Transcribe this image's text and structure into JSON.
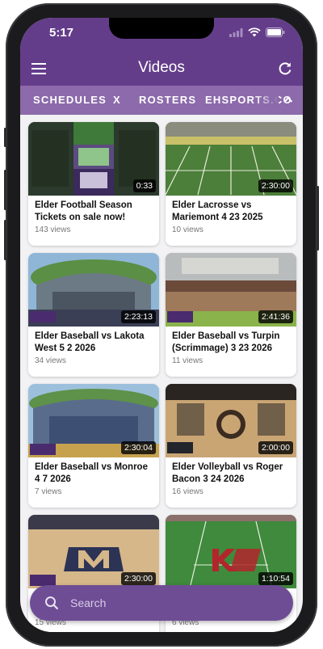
{
  "status": {
    "time": "5:17"
  },
  "header": {
    "title": "Videos"
  },
  "tabs": [
    {
      "label": "SCHEDULES"
    },
    {
      "label": "X"
    },
    {
      "label": "ROSTERS"
    },
    {
      "label": "EHSPORTS.CO"
    }
  ],
  "videos": [
    {
      "title": "Elder Football Season Tickets on sale now!",
      "views": "143 views",
      "duration": "0:33"
    },
    {
      "title": "Elder Lacrosse vs Mariemont 4 23 2025",
      "views": "10 views",
      "duration": "2:30:00"
    },
    {
      "title": "Elder Baseball vs Lakota West 5 2 2026",
      "views": "34 views",
      "duration": "2:23:13"
    },
    {
      "title": "Elder Baseball vs Turpin (Scrimmage) 3 23 2026",
      "views": "11 views",
      "duration": "2:41:36"
    },
    {
      "title": "Elder Baseball vs Monroe 4 7 2026",
      "views": "7 views",
      "duration": "2:30:04"
    },
    {
      "title": "Elder Volleyball vs Roger Bacon 3 24 2026",
      "views": "16 views",
      "duration": "2:00:00"
    },
    {
      "title": "",
      "views": "15 views",
      "duration": "2:30:00"
    },
    {
      "title": "",
      "views": "6 views",
      "duration": "1:10:54"
    }
  ],
  "search": {
    "placeholder": "Search"
  },
  "colors": {
    "primary": "#643d8a",
    "tabbar": "#8c6aab",
    "searchbar": "#6e4d95"
  }
}
